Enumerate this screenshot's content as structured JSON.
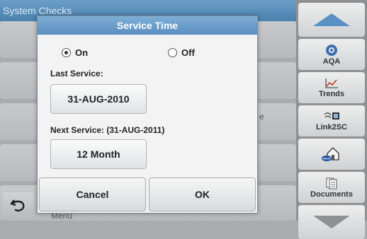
{
  "background": {
    "title": "System Checks",
    "partial_text_1": "e",
    "partial_text_2": "Menu"
  },
  "toolbar": {
    "items": [
      {
        "label": "",
        "icon": "up-arrow-icon"
      },
      {
        "label": "AQA",
        "icon": "aqa-icon"
      },
      {
        "label": "Trends",
        "icon": "trends-icon"
      },
      {
        "label": "Link2SC",
        "icon": "link2sc-icon"
      },
      {
        "label": "",
        "icon": "hach-home-icon"
      },
      {
        "label": "Documents",
        "icon": "documents-icon"
      },
      {
        "label": "",
        "icon": "down-arrow-icon"
      }
    ]
  },
  "dialog": {
    "title": "Service Time",
    "on_label": "On",
    "off_label": "Off",
    "selected": "On",
    "last_service_label": "Last Service:",
    "last_service_value": "31-AUG-2010",
    "next_service_label": "Next Service: (31-AUG-2011)",
    "next_service_value": "12 Month",
    "cancel_label": "Cancel",
    "ok_label": "OK"
  },
  "colors": {
    "title_bar": "#5b8fc0",
    "toolbar_bg": "#8e9194",
    "dialog_bg": "#f3f3f3"
  }
}
